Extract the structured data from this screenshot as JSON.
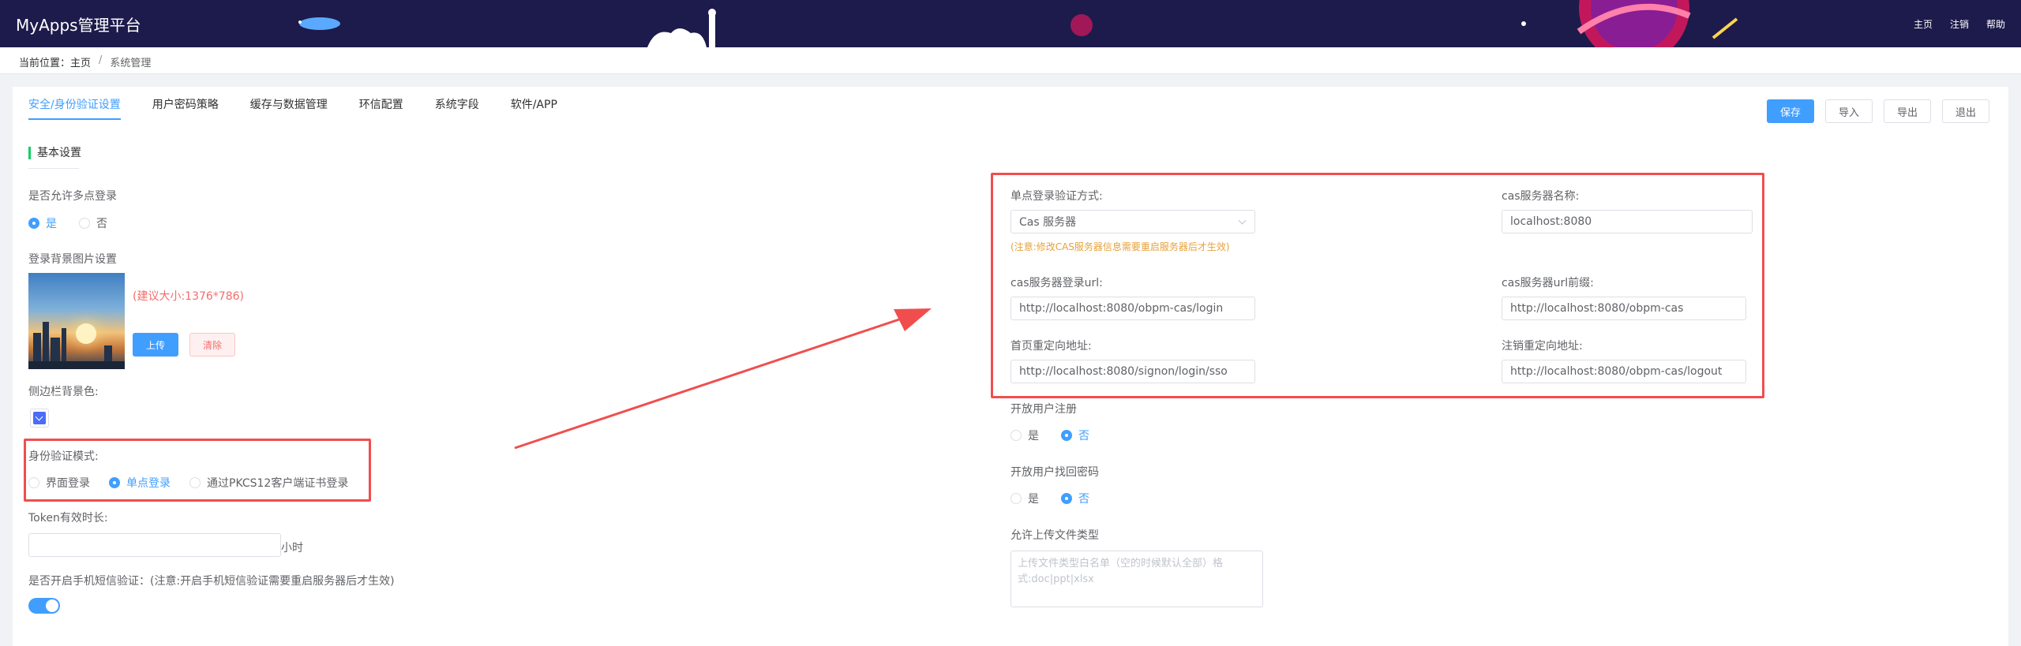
{
  "header": {
    "brand": "MyApps管理平台",
    "nav": [
      "主页",
      "注销",
      "帮助"
    ]
  },
  "breadcrumb": {
    "prefix": "当前位置：",
    "home": "主页",
    "separator": "/",
    "current": "系统管理"
  },
  "tabs": [
    "安全/身份验证设置",
    "用户密码策略",
    "缓存与数据管理",
    "环信配置",
    "系统字段",
    "软件/APP"
  ],
  "actions": {
    "save": "保存",
    "import": "导入",
    "export": "导出",
    "exit": "退出"
  },
  "left": {
    "section_title": "基本设置",
    "multi_login": {
      "label": "是否允许多点登录",
      "yes": "是",
      "no": "否",
      "selected": "yes"
    },
    "bg_image": {
      "label": "登录背景图片设置",
      "hint": "(建议大小:1376*786)",
      "upload": "上传",
      "clear": "清除"
    },
    "sidebar_color": {
      "label": "侧边栏背景色:",
      "value": "#4a6cf7"
    },
    "auth_mode": {
      "label": "身份验证模式:",
      "options": [
        "界面登录",
        "单点登录",
        "通过PKCS12客户端证书登录"
      ],
      "selected": 1
    },
    "token": {
      "label": "Token有效时长:",
      "value": "",
      "unit": "小时"
    },
    "sms": {
      "label": "是否开启手机短信验证：(注意:开启手机短信验证需要重启服务器后才生效)",
      "on": true
    }
  },
  "right": {
    "sso_method": {
      "label": "单点登录验证方式:",
      "value": "Cas 服务器",
      "note": "(注意:修改CAS服务器信息需要重启服务器后才生效)"
    },
    "cas_name": {
      "label": "cas服务器名称:",
      "value": "localhost:8080"
    },
    "cas_login_url": {
      "label": "cas服务器登录url:",
      "value": "http://localhost:8080/obpm-cas/login"
    },
    "cas_url_prefix": {
      "label": "cas服务器url前缀:",
      "value": "http://localhost:8080/obpm-cas"
    },
    "home_redirect": {
      "label": "首页重定向地址:",
      "value": "http://localhost:8080/signon/login/sso"
    },
    "logout_redirect": {
      "label": "注销重定向地址:",
      "value": "http://localhost:8080/obpm-cas/logout"
    },
    "open_register": {
      "label": "开放用户注册",
      "yes": "是",
      "no": "否",
      "selected": "no"
    },
    "open_recover": {
      "label": "开放用户找回密码",
      "yes": "是",
      "no": "否",
      "selected": "no"
    },
    "upload_types": {
      "label": "允许上传文件类型",
      "placeholder": "上传文件类型白名单（空的时候默认全部）格式:doc|ppt|xlsx"
    }
  },
  "colors": {
    "primary": "#409eff",
    "annotation": "#f04e4e",
    "header": "#1d1b4b"
  }
}
